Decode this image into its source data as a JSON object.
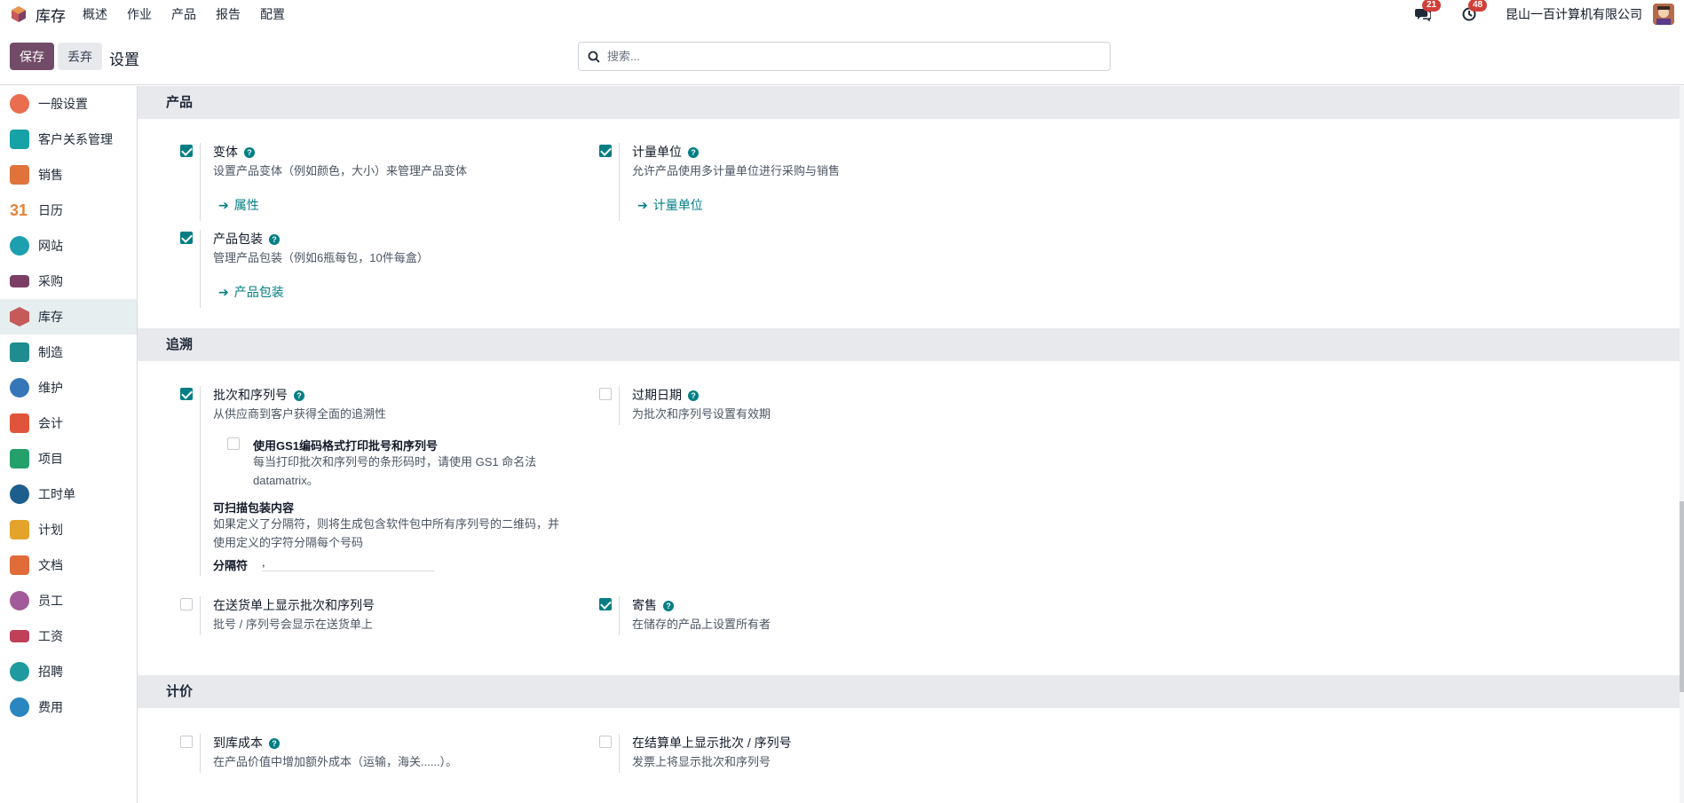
{
  "app": {
    "name": "库存",
    "menu": [
      "概述",
      "作业",
      "产品",
      "报告",
      "配置"
    ],
    "messages_count": "21",
    "activities_count": "48",
    "company": "昆山一百计算机有限公司"
  },
  "control": {
    "save_label": "保存",
    "discard_label": "丢弃",
    "title": "设置",
    "search_placeholder": "搜索..."
  },
  "sidebar": {
    "items": [
      {
        "label": "一般设置",
        "icon": "general-settings-icon",
        "color": "#e86e4f"
      },
      {
        "label": "客户关系管理",
        "icon": "crm-icon",
        "color": "#17a2a8"
      },
      {
        "label": "销售",
        "icon": "sales-icon",
        "color": "#e0733c"
      },
      {
        "label": "日历",
        "icon": "calendar-icon",
        "color": "#e5833a"
      },
      {
        "label": "网站",
        "icon": "website-icon",
        "color": "#1d9fb0"
      },
      {
        "label": "采购",
        "icon": "purchase-icon",
        "color": "#7b3f66"
      },
      {
        "label": "库存",
        "icon": "inventory-icon",
        "color": "#c45a5a"
      },
      {
        "label": "制造",
        "icon": "manufacturing-icon",
        "color": "#1f8c8f"
      },
      {
        "label": "维护",
        "icon": "maintenance-icon",
        "color": "#3576b8"
      },
      {
        "label": "会计",
        "icon": "accounting-icon",
        "color": "#e0543c"
      },
      {
        "label": "项目",
        "icon": "project-icon",
        "color": "#23a06b"
      },
      {
        "label": "工时单",
        "icon": "timesheet-icon",
        "color": "#1e5e8c"
      },
      {
        "label": "计划",
        "icon": "planning-icon",
        "color": "#e4a42c"
      },
      {
        "label": "文档",
        "icon": "documents-icon",
        "color": "#e06c3a"
      },
      {
        "label": "员工",
        "icon": "employees-icon",
        "color": "#a35a9a"
      },
      {
        "label": "工资",
        "icon": "payroll-icon",
        "color": "#c0405a"
      },
      {
        "label": "招聘",
        "icon": "recruitment-icon",
        "color": "#1f9a9e"
      },
      {
        "label": "费用",
        "icon": "expenses-icon",
        "color": "#2a86c0"
      }
    ]
  },
  "sections": {
    "products": {
      "title": "产品",
      "variants": {
        "label": "变体",
        "checked": true,
        "desc": "设置产品变体（例如颜色，大小）来管理产品变体",
        "link": "属性"
      },
      "uom": {
        "label": "计量单位",
        "checked": true,
        "desc": "允许产品使用多计量单位进行采购与销售",
        "link": "计量单位"
      },
      "packaging": {
        "label": "产品包装",
        "checked": true,
        "desc": "管理产品包装（例如6瓶每包，10件每盒）",
        "link": "产品包装"
      }
    },
    "traceability": {
      "title": "追溯",
      "lots": {
        "label": "批次和序列号",
        "checked": true,
        "desc": "从供应商到客户获得全面的追溯性"
      },
      "gs1": {
        "label": "使用GS1编码格式打印批号和序列号",
        "checked": false,
        "desc": "每当打印批次和序列号的条形码时，请使用 GS1 命名法 datamatrix。"
      },
      "scannable": {
        "label": "可扫描包装内容",
        "desc": "如果定义了分隔符，则将生成包含软件包中所有序列号的二维码，并使用定义的字符分隔每个号码",
        "separator_label": "分隔符",
        "separator_value": ","
      },
      "expiry": {
        "label": "过期日期",
        "checked": false,
        "desc": "为批次和序列号设置有效期"
      },
      "delivery_lots": {
        "label": "在送货单上显示批次和序列号",
        "checked": false,
        "desc": "批号 / 序列号会显示在送货单上"
      },
      "consignment": {
        "label": "寄售",
        "checked": true,
        "desc": "在储存的产品上设置所有者"
      }
    },
    "valuation": {
      "title": "计价",
      "landed": {
        "label": "到库成本",
        "checked": false,
        "desc": "在产品价值中增加额外成本（运输，海关......）。"
      },
      "invoice_lots": {
        "label": "在结算单上显示批次 / 序列号",
        "checked": false,
        "desc": "发票上将显示批次和序列号"
      }
    }
  },
  "colors": {
    "brand": "#714b67",
    "accent": "#017e84"
  }
}
